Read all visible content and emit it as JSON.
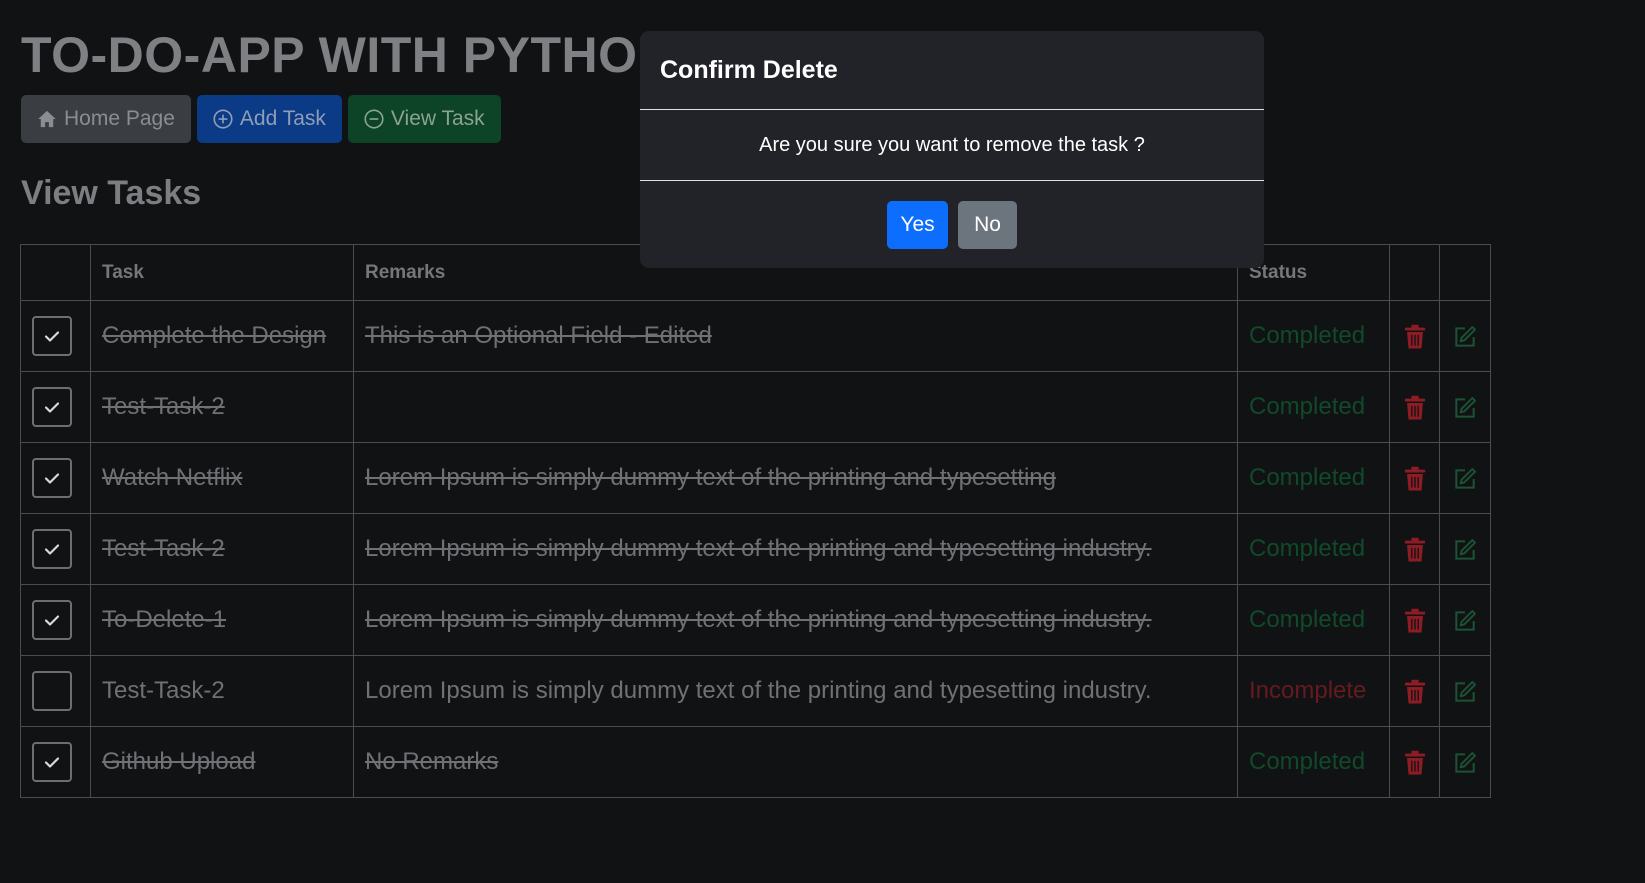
{
  "app": {
    "title": "TO-DO-APP WITH PYTHON"
  },
  "nav": {
    "home_label": "Home Page",
    "add_label": "Add Task",
    "view_label": "View Task"
  },
  "section": {
    "title": "View Tasks"
  },
  "table": {
    "headers": {
      "check": "",
      "task": "Task",
      "remarks": "Remarks",
      "status": "Status",
      "delete": "",
      "edit": ""
    },
    "rows": [
      {
        "checked": true,
        "task": "Complete the Design",
        "remarks": "This is an Optional Field - Edited",
        "status": "Completed"
      },
      {
        "checked": true,
        "task": "Test-Task-2",
        "remarks": "",
        "status": "Completed"
      },
      {
        "checked": true,
        "task": "Watch Netflix",
        "remarks": "Lorem Ipsum is simply dummy text of the printing and typesetting",
        "status": "Completed"
      },
      {
        "checked": true,
        "task": "Test-Task-2",
        "remarks": "Lorem Ipsum is simply dummy text of the printing and typesetting industry.",
        "status": "Completed"
      },
      {
        "checked": true,
        "task": "To-Delete-1",
        "remarks": "Lorem Ipsum is simply dummy text of the printing and typesetting industry.",
        "status": "Completed"
      },
      {
        "checked": false,
        "task": "Test-Task-2",
        "remarks": "Lorem Ipsum is simply dummy text of the printing and typesetting industry.",
        "status": "Incomplete"
      },
      {
        "checked": true,
        "task": "Github Upload",
        "remarks": "No Remarks",
        "status": "Completed"
      }
    ],
    "row_icons": {
      "delete": "trash-icon",
      "edit": "edit-icon"
    }
  },
  "modal": {
    "title": "Confirm Delete",
    "message": "Are you sure you want to remove the task ?",
    "yes_label": "Yes",
    "no_label": "No"
  },
  "colors": {
    "completed": "#11492b",
    "incomplete": "#661a1f",
    "trash": "#8e1c24",
    "edit": "#1a5434",
    "primary": "#0d6efd",
    "secondary": "#6c757d"
  }
}
